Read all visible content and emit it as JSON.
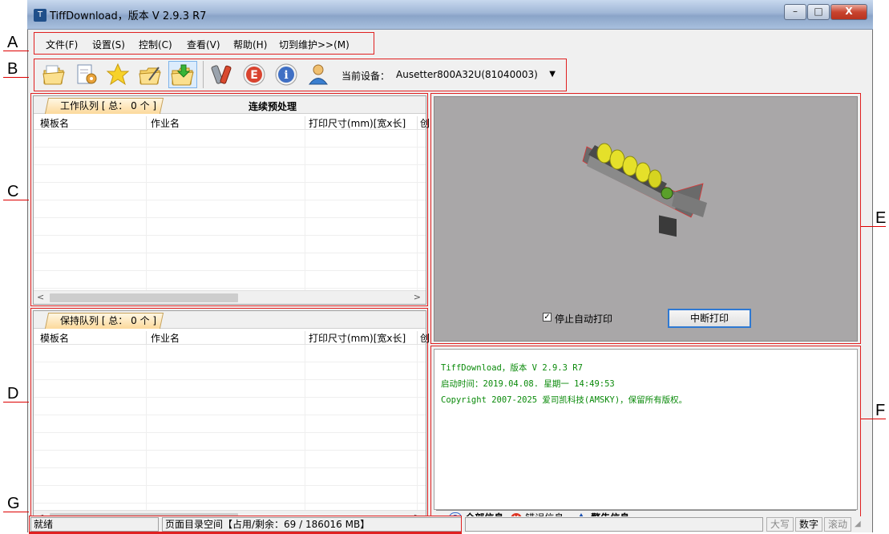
{
  "window": {
    "title": "TiffDownload，版本 V 2.9.3 R7",
    "app_icon": "tiff-app-icon",
    "minimize": "–",
    "maximize": "□",
    "close": "X"
  },
  "annotations": [
    "A",
    "B",
    "C",
    "D",
    "E",
    "F",
    "G"
  ],
  "menu": [
    {
      "label": "文件(F)"
    },
    {
      "label": "设置(S)"
    },
    {
      "label": "控制(C)"
    },
    {
      "label": "查看(V)"
    },
    {
      "label": "帮助(H)"
    },
    {
      "label": "切到维护>>(M)"
    }
  ],
  "toolbar": {
    "icons": [
      "open-folder-icon",
      "document-settings-icon",
      "star-icon",
      "folder-edit-icon",
      "folder-download-icon",
      "tools-icon",
      "e-icon",
      "info-icon",
      "user-icon"
    ],
    "device_label": "当前设备：",
    "device_value": "Ausetter800A32U(81040003)"
  },
  "work_queue": {
    "tab_label": "工作队列 [ 总： 0 个 ]",
    "extra_label": "连续预处理",
    "columns": [
      "模板名",
      "作业名",
      "打印尺寸(mm)[宽x长]",
      "创"
    ]
  },
  "hold_queue": {
    "tab_label": "保持队列 [ 总： 0 个 ]",
    "columns": [
      "模板名",
      "作业名",
      "打印尺寸(mm)[宽x长]",
      "创"
    ]
  },
  "preview": {
    "auto_print_label": "停止自动打印",
    "auto_print_checked": true,
    "abort_button": "中断打印"
  },
  "log": {
    "lines": [
      "TiffDownload，版本 V 2.9.3 R7",
      "启动时间：2019.04.08. 星期一 14:49:53",
      "Copyright 2007-2025 爱司凯科技(AMSKY)，保留所有版权。"
    ],
    "tabs": [
      {
        "label": "全部信息",
        "icon": "question-icon"
      },
      {
        "label": "错误信息",
        "icon": "error-icon"
      },
      {
        "label": "警告信息",
        "icon": "warning-icon"
      }
    ]
  },
  "status": {
    "ready": "就绪",
    "space": "页面目录空间【占用/剩余：69 / 186016  MB】",
    "caps": "大写",
    "num": "数字",
    "scroll": "滚动"
  },
  "colors": {
    "log_text": "#0a8a0a",
    "annotation": "#e02020",
    "tab_fill": "#fcd99b"
  }
}
